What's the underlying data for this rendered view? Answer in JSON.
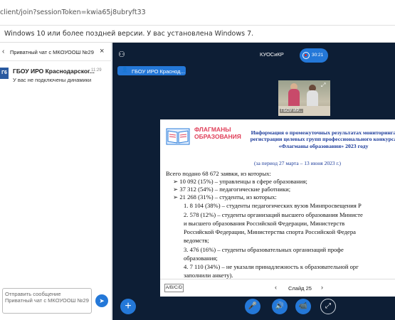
{
  "browser": {
    "url": "client/join?sessionToken=kwia65j8ubryft33",
    "warning": "Windows 10 или более поздней версии. У вас установлена Windows 7."
  },
  "chat": {
    "title": "Приватный чат с МКОУООШ №29",
    "message": {
      "avatar": "Г6",
      "sender": "ГБОУ ИРО Краснодарског...",
      "time": "11:29",
      "text": "У вас не подключены динамики"
    },
    "input_placeholder": "Отправить сообщение Приватный чат с МКОУООШ №29"
  },
  "stage": {
    "conference_title": "КУОСиКР",
    "record_time": "30:21",
    "presenter": "ГБОУ ИРО Краснод...",
    "webcam_label": "ГБОУ ИР..."
  },
  "slide": {
    "logo_text": "ФЛАГМАНЫ\nОБРАЗОВАНИЯ",
    "title": "Информация о промежуточных результатах мониторинга регистрации целевых групп профессионального конкурса «Флагманы образования» 2023 году",
    "subtitle": "(за период 27 марта – 13 июня 2023 г.)",
    "lines": [
      "Всего подано 68 672 заявки, из которых:",
      "➢ 10 092 (15%) – управленцы в сфере образования;",
      "➢ 37 312 (54%) – педагогические работники;",
      "➢ 21 268 (31%) – студенты, из которых:",
      "1.  8 104 (38%) – студенты педагогических вузов Минпросвещения Р",
      "2.   578 (12%) – студенты организаций высшего образования Министе",
      "и   высшего  образования  Российской  Федерации,  Министерств",
      "Российской Федерации, Министерства спорта Российской Федера",
      "ведомств;",
      "3.   476  (16%)  –  студенты  образовательных  организаций  профе",
      "образования;",
      "4.  7 110 (34%) – не указали принадлежность к образовательной орг",
      "заполнили анкету)."
    ],
    "lang": "A/B/C/D",
    "slide_label": "Слайд 25"
  },
  "colors": {
    "accent": "#2478d8",
    "stage_bg": "#0d1e35",
    "logo_pink": "#e0405a",
    "title_blue": "#1a3a9a"
  },
  "icons": [
    "back-chevron-icon",
    "close-icon",
    "send-icon",
    "users-icon",
    "record-icon",
    "expand-icon",
    "prev-icon",
    "next-icon",
    "plus-icon",
    "microphone-icon",
    "speaker-icon",
    "camera-icon",
    "share-screen-icon"
  ]
}
